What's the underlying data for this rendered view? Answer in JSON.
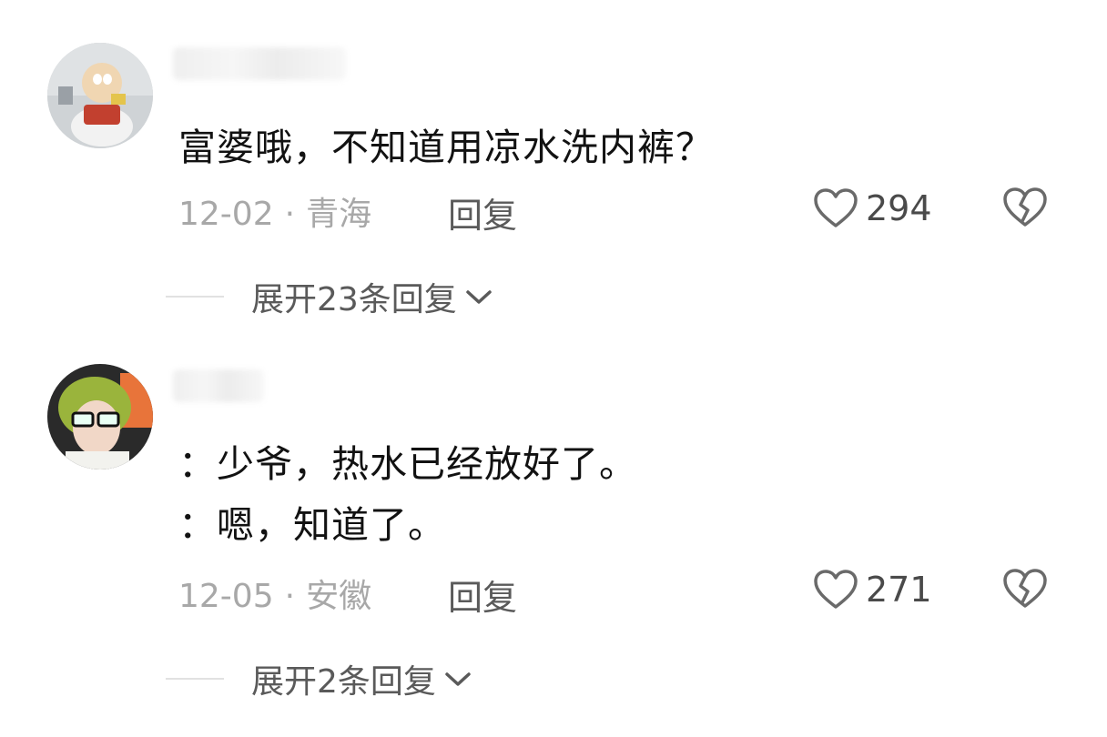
{
  "comments": [
    {
      "text_lines": [
        "富婆哦，不知道用凉水洗内裤？"
      ],
      "date": "12-02",
      "location": "青海",
      "reply_label": "回复",
      "likes": "294",
      "expand_label": "展开23条回复"
    },
    {
      "text_lines": [
        "：少爷，热水已经放好了。",
        "：嗯，知道了。"
      ],
      "date": "12-05",
      "location": "安徽",
      "reply_label": "回复",
      "likes": "271",
      "expand_label": "展开2条回复"
    }
  ],
  "separator": "·",
  "icons": {
    "like": "heart-outline-icon",
    "dislike": "broken-heart-icon",
    "expand": "chevron-down-icon"
  },
  "colors": {
    "text": "#121212",
    "meta": "#a8a8a8",
    "action": "#5a5a5a"
  }
}
